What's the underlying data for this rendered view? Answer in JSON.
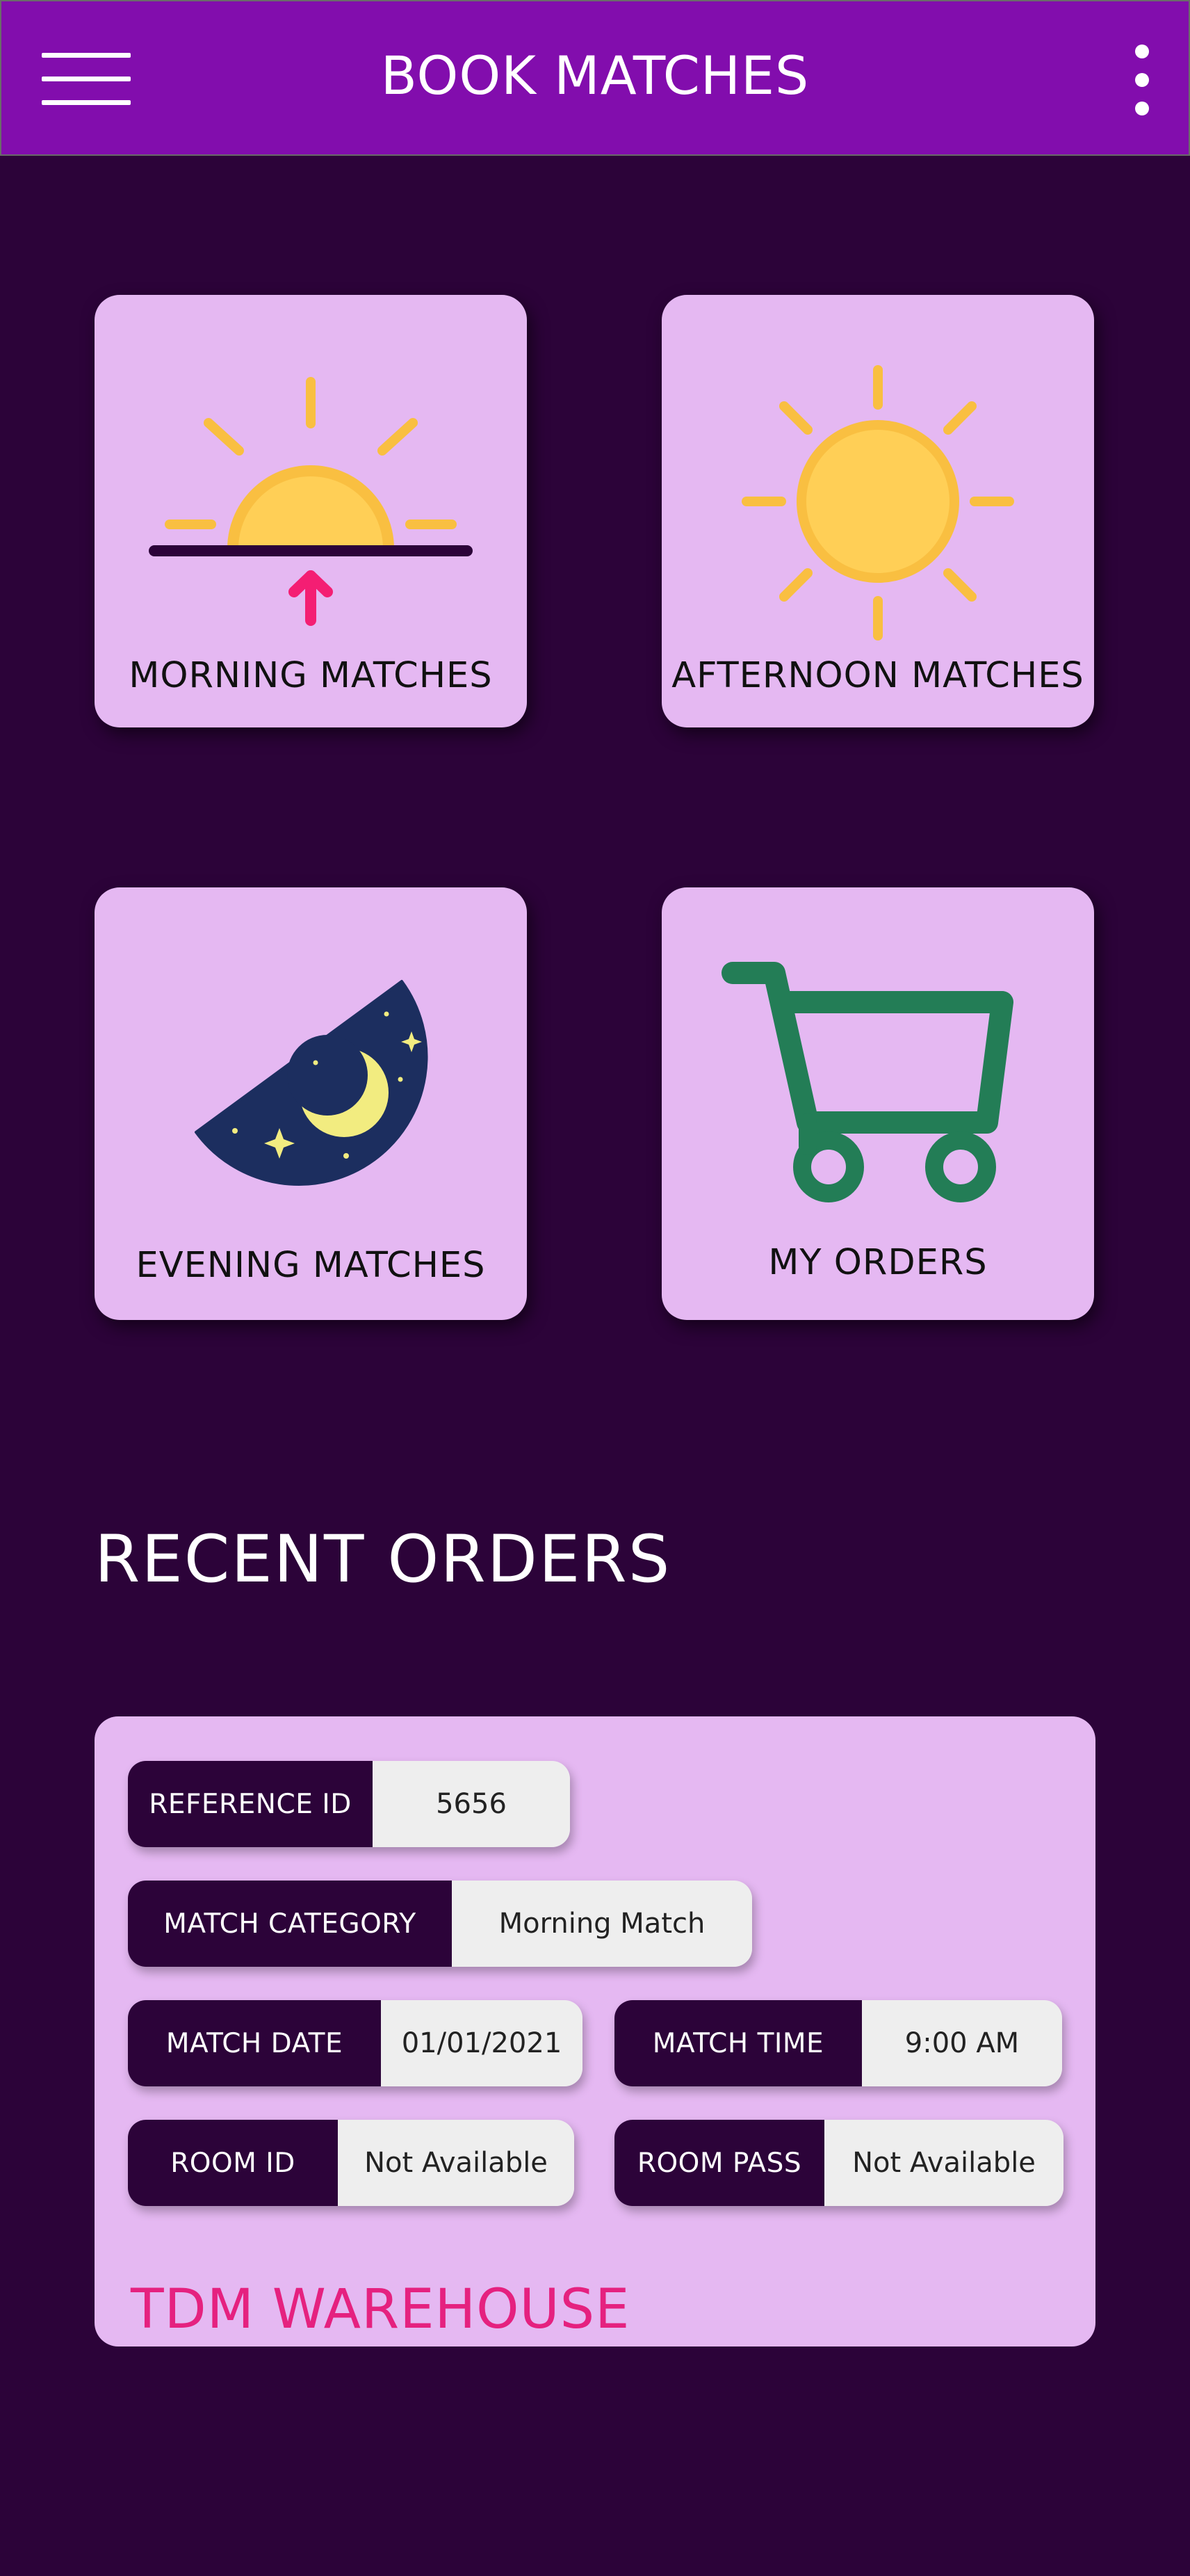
{
  "app_bar": {
    "title": "BOOK MATCHES",
    "menu_icon": "hamburger-menu-icon",
    "overflow_icon": "more-vertical-icon",
    "background_color": "#820dad"
  },
  "tiles": [
    {
      "label": "MORNING MATCHES",
      "icon": "sunrise-icon"
    },
    {
      "label": "AFTERNOON MATCHES",
      "icon": "sun-icon"
    },
    {
      "label": "EVENING MATCHES",
      "icon": "night-moon-icon"
    },
    {
      "label": "MY ORDERS",
      "icon": "shopping-cart-icon"
    }
  ],
  "recent_orders": {
    "title": "RECENT ORDERS",
    "order": {
      "reference_id": {
        "label": "REFERENCE ID",
        "value": "5656"
      },
      "match_category": {
        "label": "MATCH CATEGORY",
        "value": "Morning Match"
      },
      "match_date": {
        "label": "MATCH DATE",
        "value": "01/01/2021"
      },
      "match_time": {
        "label": "MATCH TIME",
        "value": "9:00 AM"
      },
      "room_id": {
        "label": "ROOM ID",
        "value": "Not Available"
      },
      "room_pass": {
        "label": "ROOM PASS",
        "value": "Not Available"
      },
      "brand": "TDM WAREHOUSE"
    }
  },
  "colors": {
    "page_background": "#2c0339",
    "tile_background": "#e5b8f2",
    "brand_pink": "#e5217f",
    "sun_yellow": "#ffcf56",
    "cart_green": "#237d56"
  }
}
